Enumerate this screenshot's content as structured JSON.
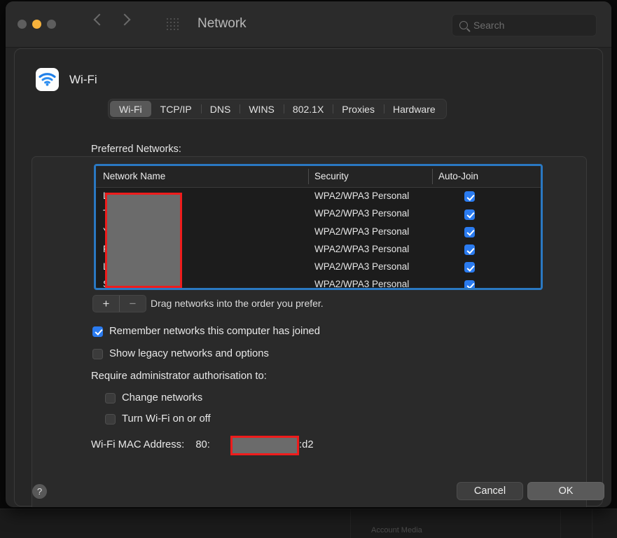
{
  "window": {
    "title": "Network",
    "traffic_lights": [
      "close",
      "minimize",
      "zoom"
    ],
    "nav_back": "back-arrow",
    "nav_forward": "forward-arrow",
    "grid_icon": "grid-apps-icon",
    "search": {
      "placeholder": "Search",
      "value": "",
      "icon": "search-icon"
    }
  },
  "sheet": {
    "icon": "wifi-icon",
    "title": "Wi-Fi",
    "tabs": [
      {
        "label": "Wi-Fi",
        "active": true
      },
      {
        "label": "TCP/IP",
        "active": false
      },
      {
        "label": "DNS",
        "active": false
      },
      {
        "label": "WINS",
        "active": false
      },
      {
        "label": "802.1X",
        "active": false
      },
      {
        "label": "Proxies",
        "active": false
      },
      {
        "label": "Hardware",
        "active": false
      }
    ]
  },
  "preferred_networks": {
    "label": "Preferred Networks:",
    "columns": [
      "Network Name",
      "Security",
      "Auto-Join"
    ],
    "rows": [
      {
        "name": "L",
        "security": "WPA2/WPA3 Personal",
        "auto_join": true
      },
      {
        "name": "T",
        "security": "WPA2/WPA3 Personal",
        "auto_join": true
      },
      {
        "name": "Y",
        "security": "WPA2/WPA3 Personal",
        "auto_join": true
      },
      {
        "name": "F",
        "security": "WPA2/WPA3 Personal",
        "auto_join": true
      },
      {
        "name": "L",
        "security": "WPA2/WPA3 Personal",
        "auto_join": true
      },
      {
        "name": "S",
        "security": "WPA2/WPA3 Personal",
        "auto_join": true
      }
    ],
    "add_button": "+",
    "remove_button": "−",
    "hint": "Drag networks into the order you prefer."
  },
  "options": {
    "remember": {
      "label": "Remember networks this computer has joined",
      "checked": true
    },
    "legacy": {
      "label": "Show legacy networks and options",
      "checked": false
    },
    "require_label": "Require administrator authorisation to:",
    "change_networks": {
      "label": "Change networks",
      "checked": false
    },
    "toggle_wifi": {
      "label": "Turn Wi-Fi on or off",
      "checked": false
    }
  },
  "mac_address": {
    "label": "Wi-Fi MAC Address:",
    "prefix": "80:",
    "suffix": ":d2"
  },
  "footer": {
    "help": "?",
    "cancel": "Cancel",
    "ok": "OK"
  },
  "background_window": {
    "text": "Account Media"
  },
  "colors": {
    "accent_blue": "#2a7bf0",
    "focus_ring": "#2a78c2",
    "redaction_border": "#ee1c1c",
    "redaction_fill": "#6b6b6b",
    "window_yellow": "#f6b23c"
  }
}
